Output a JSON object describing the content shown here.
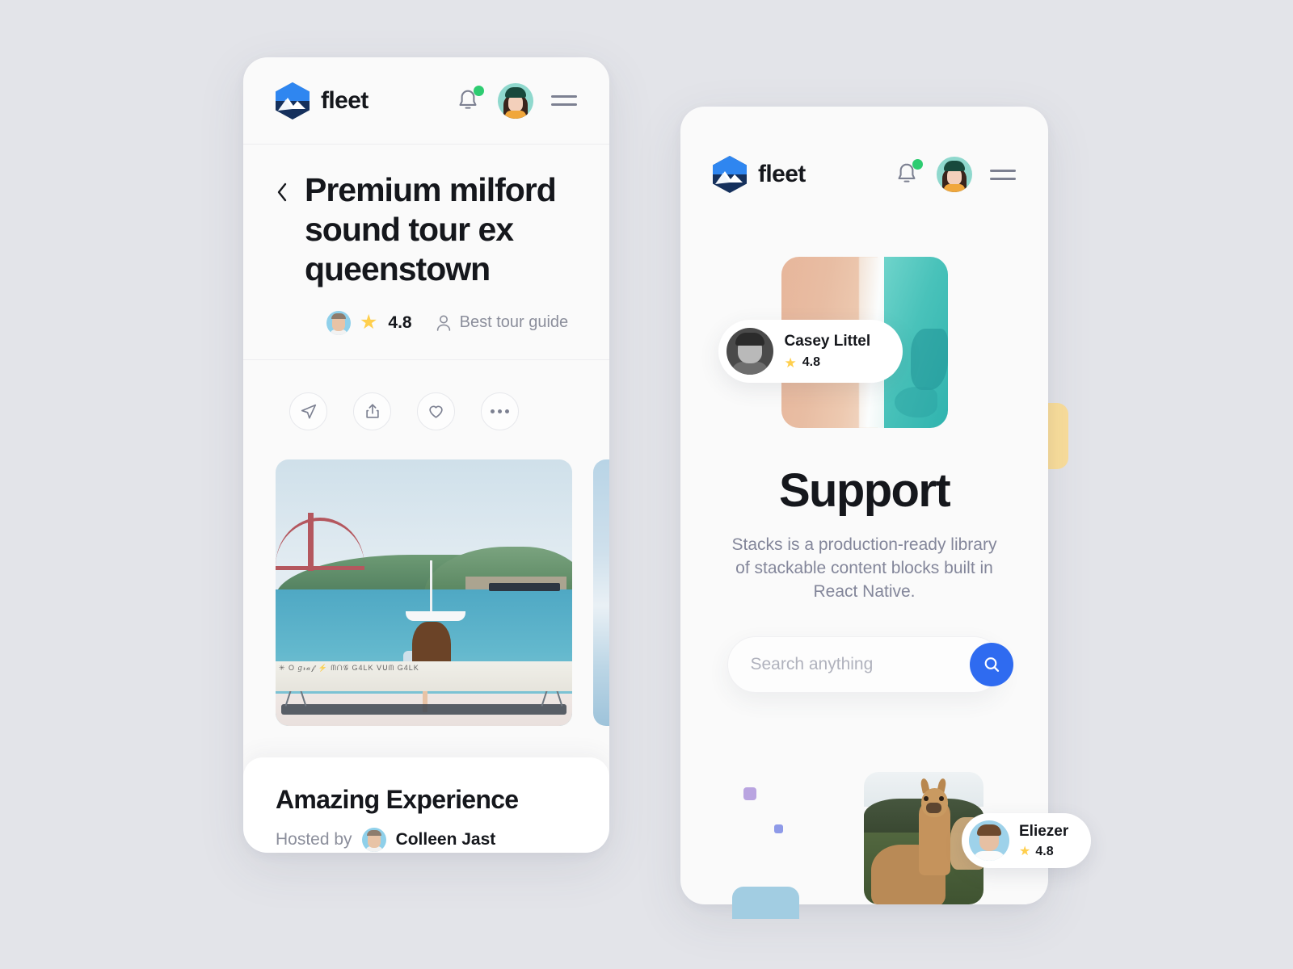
{
  "theme": {
    "background": "#e3e4e9",
    "card_surface": "#fafafa",
    "accent_blue": "#2f6bf0",
    "logo_blue": "#2f86f0",
    "logo_navy": "#15305c",
    "star_yellow": "#ffcf4d",
    "notification_green": "#2ecc71",
    "text_primary": "#15171c",
    "text_muted": "#83869a",
    "decor_yellow": "#fade9b",
    "decor_blue": "#a2cde2",
    "decor_purple": "#b9a4e0",
    "decor_indigo": "#8e9ae8"
  },
  "brand": {
    "name": "fleet",
    "logo_icon": "mountain-hexagon-logo"
  },
  "header": {
    "bell_icon": "notification-bell-icon",
    "has_unread": true,
    "avatar_icon": "user-avatar",
    "menu_icon": "hamburger-menu-icon"
  },
  "left_phone": {
    "back_icon": "chevron-left-icon",
    "title": "Premium milford sound tour ex queenstown",
    "meta": {
      "guide_avatar": "guide-avatar",
      "star_icon": "star-icon",
      "rating": "4.8",
      "person_icon": "person-outline-icon",
      "guide_label": "Best tour guide"
    },
    "actions": [
      {
        "name": "send-button",
        "icon": "paper-plane-icon"
      },
      {
        "name": "share-button",
        "icon": "share-upload-icon"
      },
      {
        "name": "favorite-button",
        "icon": "heart-icon"
      },
      {
        "name": "more-button",
        "icon": "ellipsis-icon"
      }
    ],
    "gallery": [
      {
        "name": "waterfront-photo",
        "alt": "Woman by graffiti wall with red suspension bridge and sailboat"
      },
      {
        "name": "sky-photo",
        "alt": "Clouds over sea"
      }
    ],
    "bottom_card": {
      "title": "Amazing Experience",
      "hosted_by_label": "Hosted by",
      "host_name": "Colleen Jast",
      "host_avatar": "host-avatar"
    }
  },
  "right_phone": {
    "hero": {
      "image_name": "aerial-beach-photo",
      "person_name": "Casey Littel",
      "star_icon": "star-icon",
      "rating": "4.8",
      "avatar": "casey-avatar"
    },
    "title": "Support",
    "description": "Stacks is a production-ready library of stackable content blocks built in React Native.",
    "search": {
      "placeholder": "Search anything",
      "value": "",
      "button_icon": "search-icon",
      "button_name": "search-submit-button"
    },
    "bottom": {
      "image_name": "alpaca-photo",
      "person_name": "Eliezer",
      "star_icon": "star-icon",
      "rating": "4.8",
      "avatar": "eliezer-avatar"
    },
    "decorations": [
      {
        "name": "purple-square-decoration"
      },
      {
        "name": "indigo-square-decoration"
      },
      {
        "name": "yellow-rect-decoration"
      },
      {
        "name": "blue-rect-decoration"
      }
    ]
  },
  "graffiti_text": "✳ O 𝑔𝓇𝒶𝒻 ⚡ ᗰᑎ𝒢 G4LK ᐯᑌᗰ  G4LK"
}
